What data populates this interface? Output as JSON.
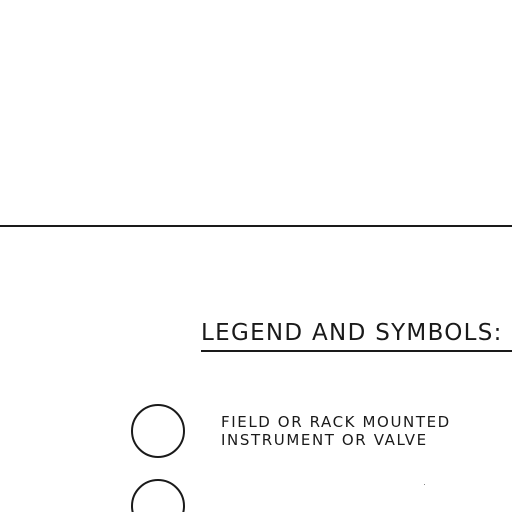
{
  "legend": {
    "title": "LEGEND AND SYMBOLS:",
    "items": [
      {
        "symbol": "circle-icon",
        "lines": [
          "FIELD OR RACK MOUNTED",
          "INSTRUMENT OR VALVE"
        ]
      },
      {
        "symbol": "circle-icon",
        "lines": []
      }
    ]
  }
}
